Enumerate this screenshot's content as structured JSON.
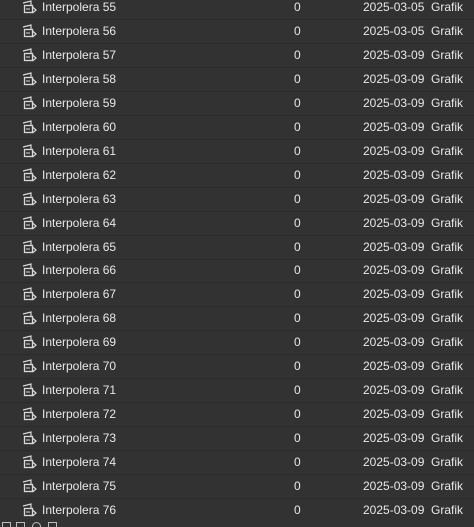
{
  "library": {
    "items": [
      {
        "name": "Interpolera 55",
        "count": "0",
        "date": "2025-03-05...",
        "type": "Grafik",
        "icon": "graphic-symbol-icon"
      },
      {
        "name": "Interpolera 56",
        "count": "0",
        "date": "2025-03-05...",
        "type": "Grafik",
        "icon": "graphic-symbol-icon"
      },
      {
        "name": "Interpolera 57",
        "count": "0",
        "date": "2025-03-09...",
        "type": "Grafik",
        "icon": "graphic-symbol-icon"
      },
      {
        "name": "Interpolera 58",
        "count": "0",
        "date": "2025-03-09...",
        "type": "Grafik",
        "icon": "graphic-symbol-icon"
      },
      {
        "name": "Interpolera 59",
        "count": "0",
        "date": "2025-03-09...",
        "type": "Grafik",
        "icon": "graphic-symbol-icon"
      },
      {
        "name": "Interpolera 60",
        "count": "0",
        "date": "2025-03-09...",
        "type": "Grafik",
        "icon": "graphic-symbol-icon"
      },
      {
        "name": "Interpolera 61",
        "count": "0",
        "date": "2025-03-09...",
        "type": "Grafik",
        "icon": "graphic-symbol-icon"
      },
      {
        "name": "Interpolera 62",
        "count": "0",
        "date": "2025-03-09...",
        "type": "Grafik",
        "icon": "graphic-symbol-icon"
      },
      {
        "name": "Interpolera 63",
        "count": "0",
        "date": "2025-03-09...",
        "type": "Grafik",
        "icon": "graphic-symbol-icon"
      },
      {
        "name": "Interpolera 64",
        "count": "0",
        "date": "2025-03-09...",
        "type": "Grafik",
        "icon": "graphic-symbol-icon"
      },
      {
        "name": "Interpolera 65",
        "count": "0",
        "date": "2025-03-09...",
        "type": "Grafik",
        "icon": "graphic-symbol-icon"
      },
      {
        "name": "Interpolera 66",
        "count": "0",
        "date": "2025-03-09...",
        "type": "Grafik",
        "icon": "graphic-symbol-icon"
      },
      {
        "name": "Interpolera 67",
        "count": "0",
        "date": "2025-03-09...",
        "type": "Grafik",
        "icon": "graphic-symbol-icon"
      },
      {
        "name": "Interpolera 68",
        "count": "0",
        "date": "2025-03-09...",
        "type": "Grafik",
        "icon": "graphic-symbol-icon"
      },
      {
        "name": "Interpolera 69",
        "count": "0",
        "date": "2025-03-09...",
        "type": "Grafik",
        "icon": "graphic-symbol-icon"
      },
      {
        "name": "Interpolera 70",
        "count": "0",
        "date": "2025-03-09...",
        "type": "Grafik",
        "icon": "graphic-symbol-icon"
      },
      {
        "name": "Interpolera 71",
        "count": "0",
        "date": "2025-03-09...",
        "type": "Grafik",
        "icon": "graphic-symbol-icon"
      },
      {
        "name": "Interpolera 72",
        "count": "0",
        "date": "2025-03-09...",
        "type": "Grafik",
        "icon": "graphic-symbol-icon"
      },
      {
        "name": "Interpolera 73",
        "count": "0",
        "date": "2025-03-09...",
        "type": "Grafik",
        "icon": "graphic-symbol-icon"
      },
      {
        "name": "Interpolera 74",
        "count": "0",
        "date": "2025-03-09...",
        "type": "Grafik",
        "icon": "graphic-symbol-icon"
      },
      {
        "name": "Interpolera 75",
        "count": "0",
        "date": "2025-03-09...",
        "type": "Grafik",
        "icon": "graphic-symbol-icon"
      },
      {
        "name": "Interpolera 76",
        "count": "0",
        "date": "2025-03-09...",
        "type": "Grafik",
        "icon": "graphic-symbol-icon"
      }
    ]
  },
  "bottom_bar": {
    "buttons": [
      {
        "icon": "new-symbol-icon"
      },
      {
        "icon": "new-folder-icon"
      },
      {
        "icon": "properties-icon"
      },
      {
        "icon": "delete-icon"
      }
    ]
  },
  "colors": {
    "background": "#323232",
    "text": "#e8e8e8",
    "icon": "#d9d9d9"
  }
}
